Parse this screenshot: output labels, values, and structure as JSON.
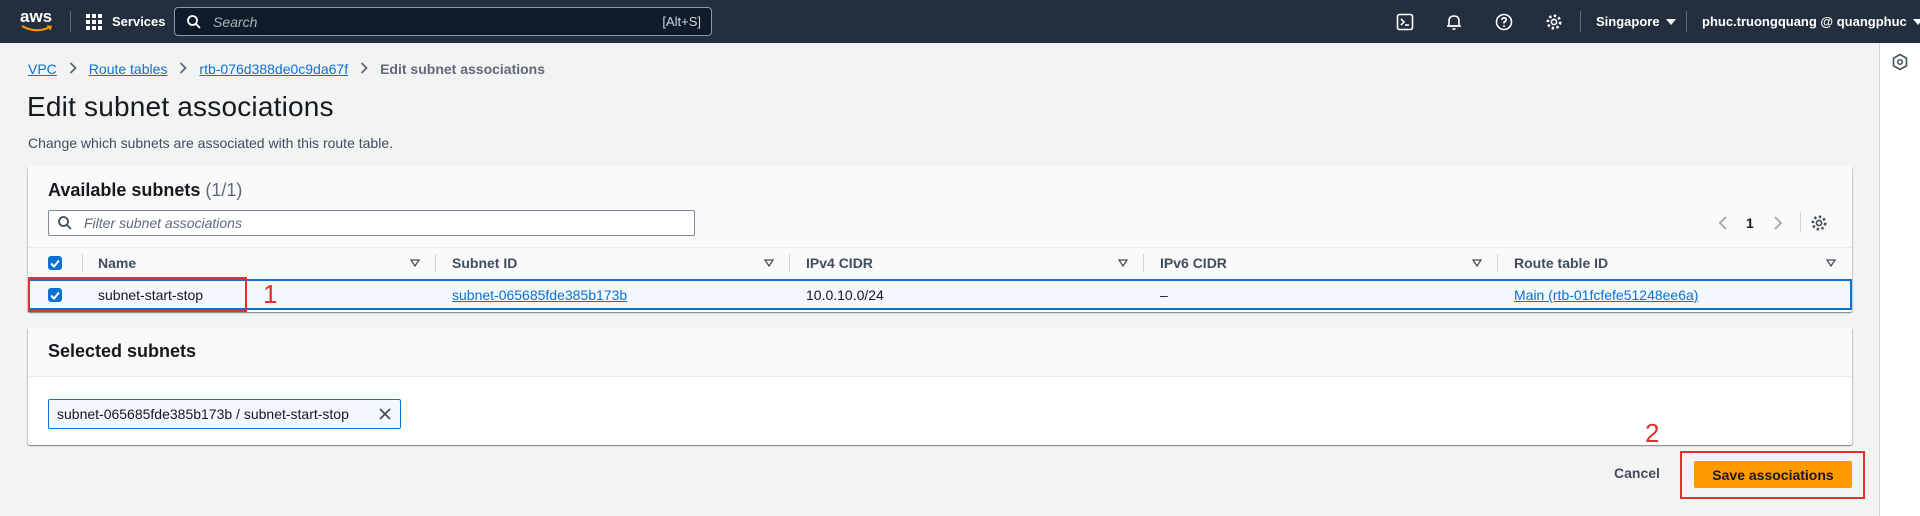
{
  "topnav": {
    "logo_text": "aws",
    "services_label": "Services",
    "search_placeholder": "Search",
    "search_shortcut": "[Alt+S]",
    "region": "Singapore",
    "account": "phuc.truongquang @ quangphuc"
  },
  "breadcrumb": {
    "items": [
      "VPC",
      "Route tables",
      "rtb-076d388de0c9da67f"
    ],
    "current": "Edit subnet associations"
  },
  "page": {
    "title": "Edit subnet associations",
    "description": "Change which subnets are associated with this route table."
  },
  "available": {
    "title": "Available subnets",
    "count": "(1/1)",
    "filter_placeholder": "Filter subnet associations",
    "page_number": "1",
    "columns": [
      "Name",
      "Subnet ID",
      "IPv4 CIDR",
      "IPv6 CIDR",
      "Route table ID"
    ],
    "rows": [
      {
        "name": "subnet-start-stop",
        "subnet_id": "subnet-065685fde385b173b",
        "ipv4": "10.0.10.0/24",
        "ipv6": "–",
        "route_table": "Main (rtb-01fcfefe51248ee6a)",
        "selected": true
      }
    ]
  },
  "selected": {
    "title": "Selected subnets",
    "token": "subnet-065685fde385b173b / subnet-start-stop"
  },
  "actions": {
    "cancel": "Cancel",
    "save": "Save associations"
  },
  "annotations": {
    "one": "1",
    "two": "2"
  },
  "colors": {
    "nav_bg": "#232f3e",
    "link": "#0972d3",
    "primary_button": "#ff9900",
    "annotation": "#e0302f"
  }
}
